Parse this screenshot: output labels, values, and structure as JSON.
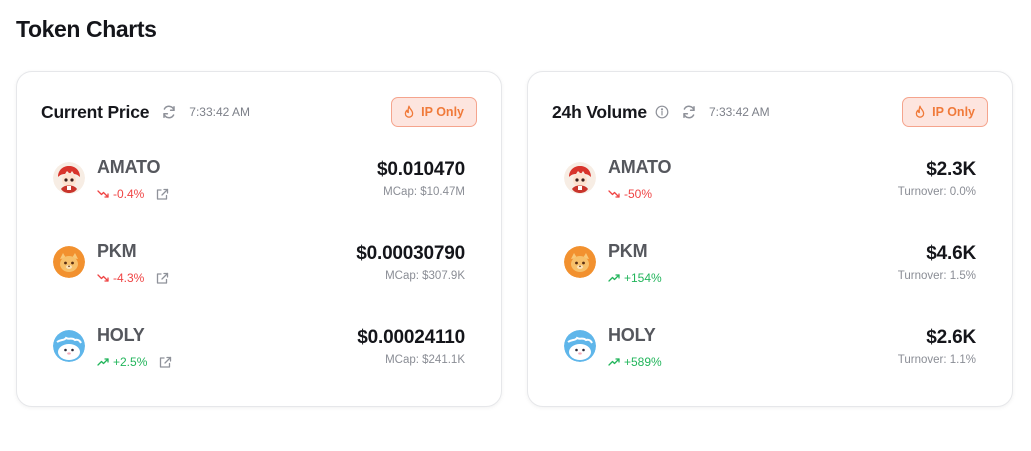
{
  "page": {
    "title": "Token Charts"
  },
  "price_card": {
    "title": "Current Price",
    "time": "7:33:42 AM",
    "badge": "IP Only",
    "rows": [
      {
        "symbol": "AMATO",
        "change": "-0.4%",
        "direction": "down",
        "value": "$0.010470",
        "sub": "MCap: $10.47M",
        "avatar": "amato-avatar"
      },
      {
        "symbol": "PKM",
        "change": "-4.3%",
        "direction": "down",
        "value": "$0.00030790",
        "sub": "MCap: $307.9K",
        "avatar": "pkm-avatar"
      },
      {
        "symbol": "HOLY",
        "change": "+2.5%",
        "direction": "up",
        "value": "$0.00024110",
        "sub": "MCap: $241.1K",
        "avatar": "holy-avatar"
      }
    ]
  },
  "volume_card": {
    "title": "24h Volume",
    "time": "7:33:42 AM",
    "badge": "IP Only",
    "rows": [
      {
        "symbol": "AMATO",
        "change": "-50%",
        "direction": "down",
        "value": "$2.3K",
        "sub": "Turnover: 0.0%",
        "avatar": "amato-avatar"
      },
      {
        "symbol": "PKM",
        "change": "+154%",
        "direction": "up",
        "value": "$4.6K",
        "sub": "Turnover: 1.5%",
        "avatar": "pkm-avatar"
      },
      {
        "symbol": "HOLY",
        "change": "+589%",
        "direction": "up",
        "value": "$2.6K",
        "sub": "Turnover: 1.1%",
        "avatar": "holy-avatar"
      }
    ]
  },
  "colors": {
    "down": "#ef4444",
    "up": "#22b55b",
    "badge_text": "#f07a3a",
    "badge_bg": "#fde5df"
  },
  "icons": [
    "refresh-icon",
    "info-icon",
    "flame-icon",
    "trend-down-icon",
    "trend-up-icon",
    "external-link-icon"
  ]
}
